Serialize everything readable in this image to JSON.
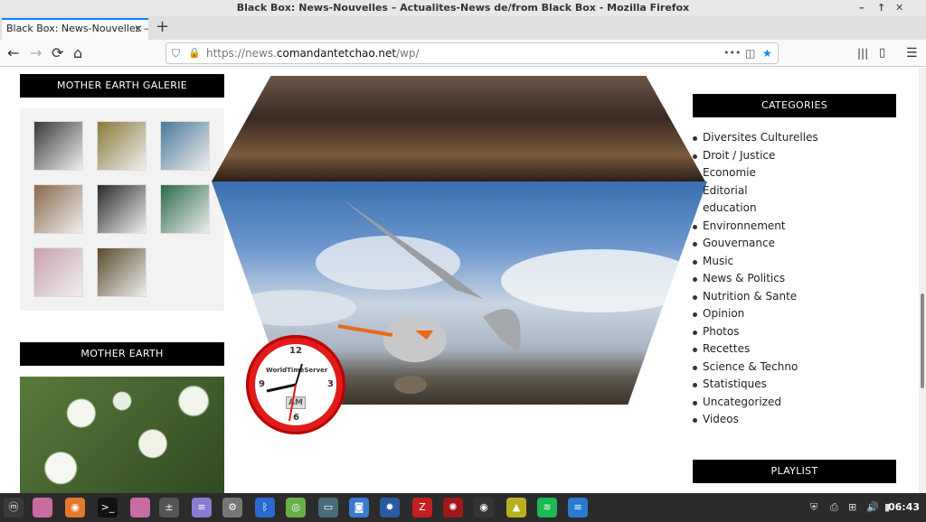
{
  "window": {
    "title": "Black Box: News-Nouvelles – Actualites-News de/from Black Box - Mozilla Firefox",
    "controls": [
      "–",
      "↑",
      "✕"
    ]
  },
  "tab": {
    "label": "Black Box: News-Nouvelles – A",
    "close": "✕",
    "new_tab": "+"
  },
  "nav": {
    "back": "←",
    "forward": "→",
    "reload": "⟳",
    "home": "⌂",
    "url_scheme": "https://news.",
    "url_domain": "comandantetchao.net",
    "url_path": "/wp/",
    "more": "•••",
    "library": "|||",
    "sidebar": "▯",
    "menu": "☰"
  },
  "left": {
    "gallery_title": "MOTHER EARTH GALERIE",
    "earth_title": "MOTHER EARTH",
    "thumbs": [
      {
        "name": "waterfall",
        "color": "#3a3a3a"
      },
      {
        "name": "field-birds",
        "color": "#8a7a3a"
      },
      {
        "name": "heron-water",
        "color": "#4a7a9a"
      },
      {
        "name": "stork",
        "color": "#8a6a4a"
      },
      {
        "name": "pelicans",
        "color": "#2a2a2a"
      },
      {
        "name": "peacock",
        "color": "#2a6a4a"
      },
      {
        "name": "flamingos",
        "color": "#c9a0b0"
      },
      {
        "name": "mandarin-duck",
        "color": "#5a4a2a"
      }
    ]
  },
  "right": {
    "categories_title": "CATEGORIES",
    "categories": [
      {
        "label": "Diversites Culturelles",
        "bullet": true
      },
      {
        "label": "Droit / Justice",
        "bullet": true
      },
      {
        "label": "Economie",
        "bullet": false
      },
      {
        "label": "Editorial",
        "bullet": false
      },
      {
        "label": "education",
        "bullet": false
      },
      {
        "label": "Environnement",
        "bullet": true
      },
      {
        "label": "Gouvernance",
        "bullet": true
      },
      {
        "label": "Music",
        "bullet": true
      },
      {
        "label": "News & Politics",
        "bullet": true
      },
      {
        "label": "Nutrition & Sante",
        "bullet": true
      },
      {
        "label": "Opinion",
        "bullet": true
      },
      {
        "label": "Photos",
        "bullet": true
      },
      {
        "label": "Recettes",
        "bullet": true
      },
      {
        "label": "Science & Techno",
        "bullet": true
      },
      {
        "label": "Statistiques",
        "bullet": true
      },
      {
        "label": "Uncategorized",
        "bullet": true
      },
      {
        "label": "Videos",
        "bullet": true
      }
    ],
    "playlist_title": "PLAYLIST"
  },
  "clock": {
    "brand": "WorldTimeServer",
    "ampm": "AM",
    "n12": "12",
    "n3": "3",
    "n6": "6",
    "n9": "9"
  },
  "taskbar": {
    "time": "06:43",
    "apps": [
      {
        "name": "menu",
        "color": "#3a3a3a",
        "glyph": "ⓜ"
      },
      {
        "name": "files-pink",
        "color": "#c86ba0",
        "glyph": ""
      },
      {
        "name": "firefox",
        "color": "#e8772e",
        "glyph": "◉"
      },
      {
        "name": "terminal",
        "color": "#111",
        "glyph": ">_"
      },
      {
        "name": "files",
        "color": "#c86ba0",
        "glyph": ""
      },
      {
        "name": "calculator",
        "color": "#555",
        "glyph": "±"
      },
      {
        "name": "text-editor",
        "color": "#8a7ad0",
        "glyph": "≡"
      },
      {
        "name": "settings",
        "color": "#777",
        "glyph": "⚙"
      },
      {
        "name": "bluetooth",
        "color": "#2a6ad0",
        "glyph": "ᛒ"
      },
      {
        "name": "network",
        "color": "#6ab04a",
        "glyph": "◎"
      },
      {
        "name": "display",
        "color": "#4a6a7a",
        "glyph": "▭"
      },
      {
        "name": "screenshot",
        "color": "#3a7ad0",
        "glyph": "◙"
      },
      {
        "name": "gear-blue",
        "color": "#2a5aa0",
        "glyph": "✹"
      },
      {
        "name": "filezilla",
        "color": "#c02020",
        "glyph": "Z"
      },
      {
        "name": "red-app",
        "color": "#a01818",
        "glyph": "✺"
      },
      {
        "name": "reels",
        "color": "#333",
        "glyph": "◉"
      },
      {
        "name": "image-viewer",
        "color": "#b8b020",
        "glyph": "▲"
      },
      {
        "name": "spotify",
        "color": "#1db954",
        "glyph": "≋"
      },
      {
        "name": "notes",
        "color": "#2a7ad0",
        "glyph": "≡"
      }
    ],
    "tray": [
      "⛨",
      "⎙",
      "⊞",
      "🔊",
      "▮"
    ]
  }
}
